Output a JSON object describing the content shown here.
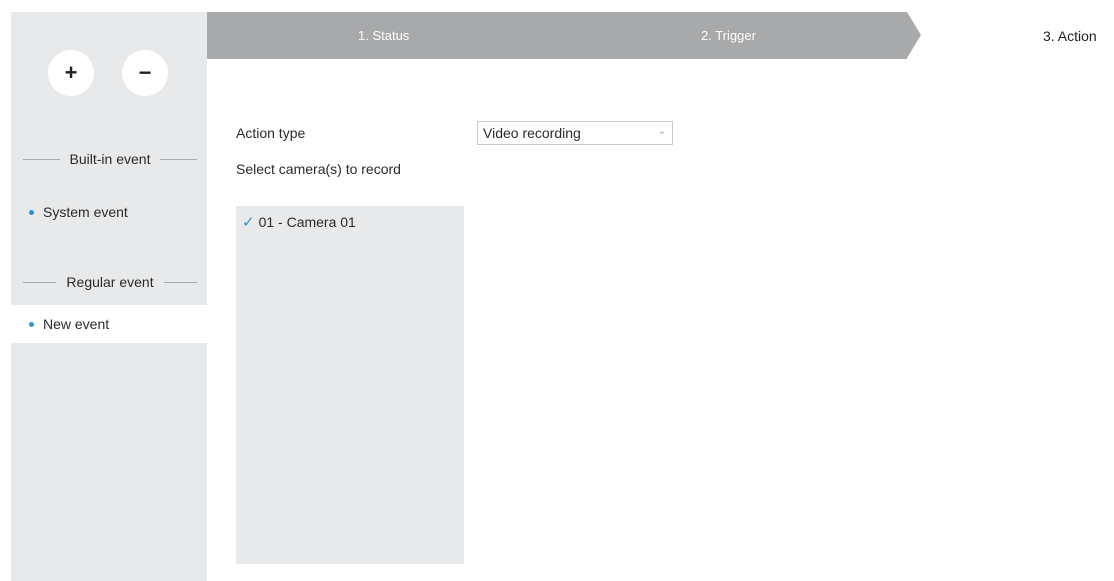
{
  "sidebar": {
    "add_label": "+",
    "remove_label": "−",
    "builtin_header": "Built-in event",
    "builtin_items": [
      {
        "label": "System event"
      }
    ],
    "regular_header": "Regular event",
    "regular_items": [
      {
        "label": "New event",
        "selected": true
      }
    ]
  },
  "steps": [
    {
      "label": "1. Status"
    },
    {
      "label": "2. Trigger"
    },
    {
      "label": "3. Action",
      "active": true
    }
  ],
  "form": {
    "action_type_label": "Action type",
    "action_type_value": "Video recording",
    "select_camera_label": "Select camera(s) to record",
    "cameras": [
      {
        "label": "01 - Camera 01",
        "checked": true
      }
    ]
  },
  "colors": {
    "accent": "#2a95d6",
    "sidebar_bg": "#e8e9ea",
    "steps_bar_bg": "#a7a9ab"
  }
}
